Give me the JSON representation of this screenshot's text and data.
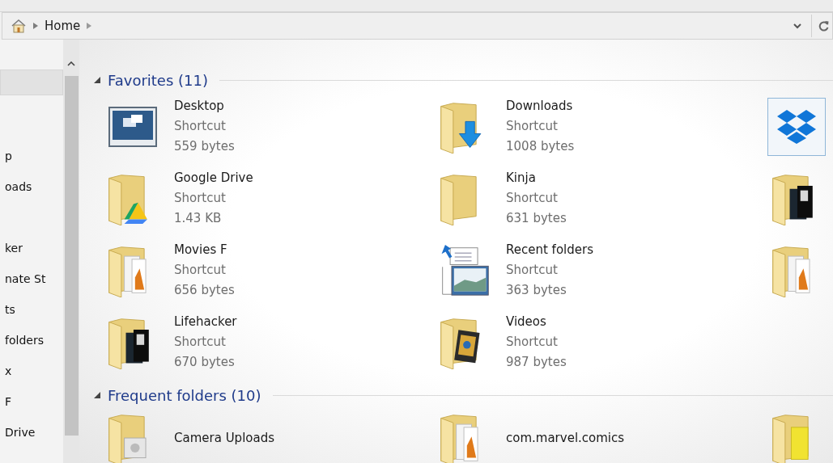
{
  "address_bar": {
    "path": [
      "Home"
    ]
  },
  "nav_pane": {
    "items": [
      {
        "selected": true
      },
      {
        "label": "p",
        "selected": false
      },
      {
        "label": "oads",
        "selected": false
      },
      {
        "selected": false
      },
      {
        "label": "ker",
        "selected": false
      },
      {
        "label": "nate St",
        "selected": false
      },
      {
        "label": "ts",
        "selected": false
      },
      {
        "label": "folders",
        "selected": false
      },
      {
        "label": "x",
        "selected": false
      },
      {
        "label": "F",
        "selected": false
      },
      {
        "label": "Drive",
        "selected": false
      }
    ]
  },
  "sections": [
    {
      "title": "Favorites (11)",
      "expanded": true,
      "items": [
        {
          "kind": "desktop",
          "name": "Desktop",
          "type": "Shortcut",
          "size": "559 bytes",
          "selected": false
        },
        {
          "kind": "downloads",
          "name": "Downloads",
          "type": "Shortcut",
          "size": "1008 bytes",
          "selected": false
        },
        {
          "kind": "dropbox",
          "selected": true
        },
        {
          "kind": "drive",
          "name": "Google Drive",
          "type": "Shortcut",
          "size": "1.43 KB",
          "selected": false
        },
        {
          "kind": "folder",
          "name": "Kinja",
          "type": "Shortcut",
          "size": "631 bytes",
          "selected": false
        },
        {
          "kind": "photo-folder",
          "selected": false
        },
        {
          "kind": "picture-folder",
          "name": "Movies F",
          "type": "Shortcut",
          "size": "656 bytes",
          "selected": false
        },
        {
          "kind": "recent",
          "name": "Recent folders",
          "type": "Shortcut",
          "size": "363 bytes",
          "selected": false
        },
        {
          "kind": "picture-folder",
          "selected": false
        },
        {
          "kind": "photo-folder",
          "name": "Lifehacker",
          "type": "Shortcut",
          "size": "670 bytes",
          "selected": false
        },
        {
          "kind": "videos",
          "name": "Videos",
          "type": "Shortcut",
          "size": "987 bytes",
          "selected": false
        }
      ]
    },
    {
      "title": "Frequent folders (10)",
      "expanded": true,
      "items": [
        {
          "kind": "camera-folder",
          "name": "Camera Uploads",
          "selected": false
        },
        {
          "kind": "picture-folder",
          "name": "com.marvel.comics",
          "selected": false
        },
        {
          "kind": "yellow-folder",
          "selected": false
        }
      ]
    }
  ]
}
